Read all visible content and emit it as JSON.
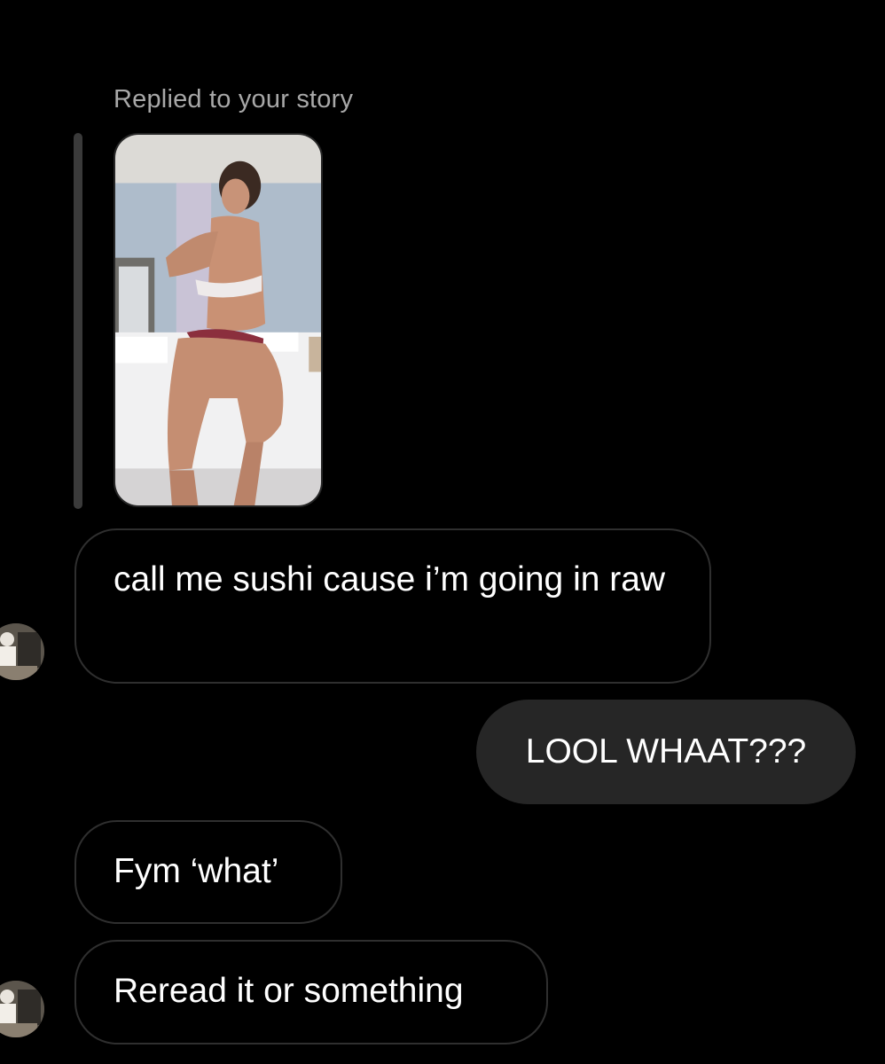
{
  "story_reply": {
    "caption": "Replied to your story",
    "thumbnail_icon": "story-photo-thumbnail"
  },
  "messages": [
    {
      "direction": "incoming",
      "text": "call me sushi cause i’m going in raw"
    },
    {
      "direction": "outgoing",
      "text": "LOOL WHAAT???"
    },
    {
      "direction": "incoming",
      "text": "Fym ‘what’"
    },
    {
      "direction": "incoming",
      "text": "Reread it or something"
    }
  ],
  "colors": {
    "background": "#000000",
    "caption": "#a8a8a8",
    "incoming_border": "#2f2f2f",
    "outgoing_bubble": "#262626",
    "text": "#ffffff"
  }
}
